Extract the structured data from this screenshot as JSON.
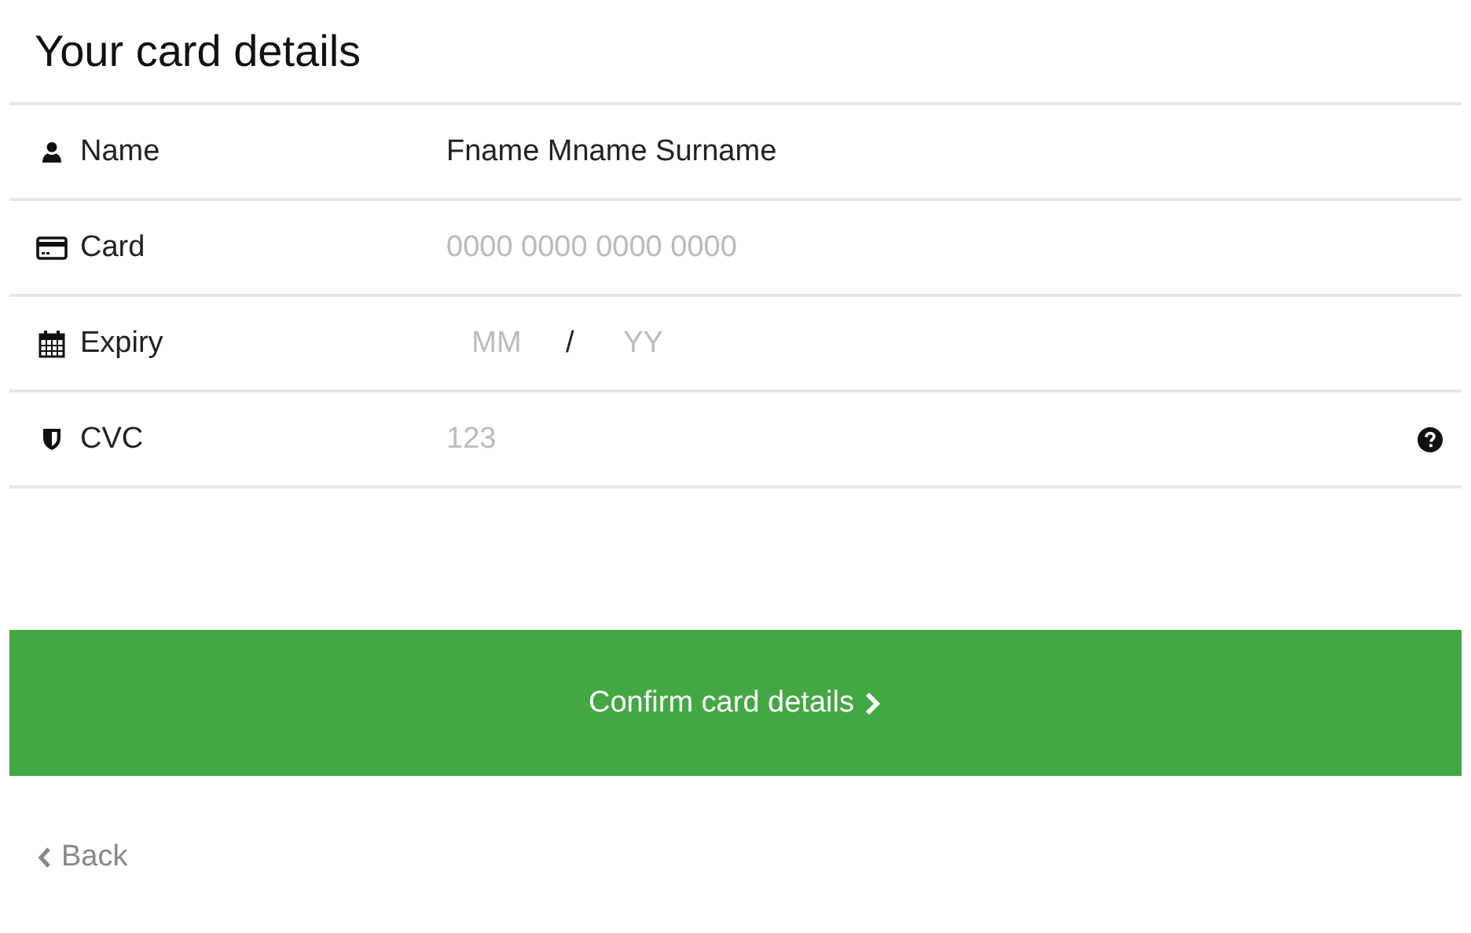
{
  "title": "Your card details",
  "rows": [
    {
      "kind": "name",
      "label": "Name",
      "value": "Fname Mname Surname"
    },
    {
      "kind": "card",
      "label": "Card",
      "placeholder": "0000 0000 0000 0000"
    },
    {
      "kind": "expiry",
      "label": "Expiry",
      "month_placeholder": "MM",
      "separator": "/",
      "year_placeholder": "YY"
    },
    {
      "kind": "cvc",
      "label": "CVC",
      "placeholder": "123",
      "help": true
    }
  ],
  "confirm_button": "Confirm card details",
  "back_link": "Back"
}
